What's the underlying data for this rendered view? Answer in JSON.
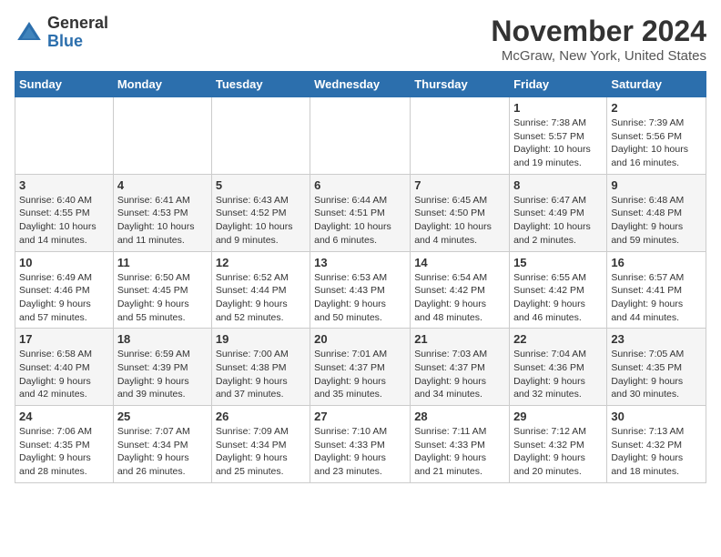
{
  "logo": {
    "general": "General",
    "blue": "Blue"
  },
  "title": "November 2024",
  "location": "McGraw, New York, United States",
  "weekdays": [
    "Sunday",
    "Monday",
    "Tuesday",
    "Wednesday",
    "Thursday",
    "Friday",
    "Saturday"
  ],
  "weeks": [
    [
      {
        "day": "",
        "info": ""
      },
      {
        "day": "",
        "info": ""
      },
      {
        "day": "",
        "info": ""
      },
      {
        "day": "",
        "info": ""
      },
      {
        "day": "",
        "info": ""
      },
      {
        "day": "1",
        "info": "Sunrise: 7:38 AM\nSunset: 5:57 PM\nDaylight: 10 hours\nand 19 minutes."
      },
      {
        "day": "2",
        "info": "Sunrise: 7:39 AM\nSunset: 5:56 PM\nDaylight: 10 hours\nand 16 minutes."
      }
    ],
    [
      {
        "day": "3",
        "info": "Sunrise: 6:40 AM\nSunset: 4:55 PM\nDaylight: 10 hours\nand 14 minutes."
      },
      {
        "day": "4",
        "info": "Sunrise: 6:41 AM\nSunset: 4:53 PM\nDaylight: 10 hours\nand 11 minutes."
      },
      {
        "day": "5",
        "info": "Sunrise: 6:43 AM\nSunset: 4:52 PM\nDaylight: 10 hours\nand 9 minutes."
      },
      {
        "day": "6",
        "info": "Sunrise: 6:44 AM\nSunset: 4:51 PM\nDaylight: 10 hours\nand 6 minutes."
      },
      {
        "day": "7",
        "info": "Sunrise: 6:45 AM\nSunset: 4:50 PM\nDaylight: 10 hours\nand 4 minutes."
      },
      {
        "day": "8",
        "info": "Sunrise: 6:47 AM\nSunset: 4:49 PM\nDaylight: 10 hours\nand 2 minutes."
      },
      {
        "day": "9",
        "info": "Sunrise: 6:48 AM\nSunset: 4:48 PM\nDaylight: 9 hours\nand 59 minutes."
      }
    ],
    [
      {
        "day": "10",
        "info": "Sunrise: 6:49 AM\nSunset: 4:46 PM\nDaylight: 9 hours\nand 57 minutes."
      },
      {
        "day": "11",
        "info": "Sunrise: 6:50 AM\nSunset: 4:45 PM\nDaylight: 9 hours\nand 55 minutes."
      },
      {
        "day": "12",
        "info": "Sunrise: 6:52 AM\nSunset: 4:44 PM\nDaylight: 9 hours\nand 52 minutes."
      },
      {
        "day": "13",
        "info": "Sunrise: 6:53 AM\nSunset: 4:43 PM\nDaylight: 9 hours\nand 50 minutes."
      },
      {
        "day": "14",
        "info": "Sunrise: 6:54 AM\nSunset: 4:42 PM\nDaylight: 9 hours\nand 48 minutes."
      },
      {
        "day": "15",
        "info": "Sunrise: 6:55 AM\nSunset: 4:42 PM\nDaylight: 9 hours\nand 46 minutes."
      },
      {
        "day": "16",
        "info": "Sunrise: 6:57 AM\nSunset: 4:41 PM\nDaylight: 9 hours\nand 44 minutes."
      }
    ],
    [
      {
        "day": "17",
        "info": "Sunrise: 6:58 AM\nSunset: 4:40 PM\nDaylight: 9 hours\nand 42 minutes."
      },
      {
        "day": "18",
        "info": "Sunrise: 6:59 AM\nSunset: 4:39 PM\nDaylight: 9 hours\nand 39 minutes."
      },
      {
        "day": "19",
        "info": "Sunrise: 7:00 AM\nSunset: 4:38 PM\nDaylight: 9 hours\nand 37 minutes."
      },
      {
        "day": "20",
        "info": "Sunrise: 7:01 AM\nSunset: 4:37 PM\nDaylight: 9 hours\nand 35 minutes."
      },
      {
        "day": "21",
        "info": "Sunrise: 7:03 AM\nSunset: 4:37 PM\nDaylight: 9 hours\nand 34 minutes."
      },
      {
        "day": "22",
        "info": "Sunrise: 7:04 AM\nSunset: 4:36 PM\nDaylight: 9 hours\nand 32 minutes."
      },
      {
        "day": "23",
        "info": "Sunrise: 7:05 AM\nSunset: 4:35 PM\nDaylight: 9 hours\nand 30 minutes."
      }
    ],
    [
      {
        "day": "24",
        "info": "Sunrise: 7:06 AM\nSunset: 4:35 PM\nDaylight: 9 hours\nand 28 minutes."
      },
      {
        "day": "25",
        "info": "Sunrise: 7:07 AM\nSunset: 4:34 PM\nDaylight: 9 hours\nand 26 minutes."
      },
      {
        "day": "26",
        "info": "Sunrise: 7:09 AM\nSunset: 4:34 PM\nDaylight: 9 hours\nand 25 minutes."
      },
      {
        "day": "27",
        "info": "Sunrise: 7:10 AM\nSunset: 4:33 PM\nDaylight: 9 hours\nand 23 minutes."
      },
      {
        "day": "28",
        "info": "Sunrise: 7:11 AM\nSunset: 4:33 PM\nDaylight: 9 hours\nand 21 minutes."
      },
      {
        "day": "29",
        "info": "Sunrise: 7:12 AM\nSunset: 4:32 PM\nDaylight: 9 hours\nand 20 minutes."
      },
      {
        "day": "30",
        "info": "Sunrise: 7:13 AM\nSunset: 4:32 PM\nDaylight: 9 hours\nand 18 minutes."
      }
    ]
  ]
}
